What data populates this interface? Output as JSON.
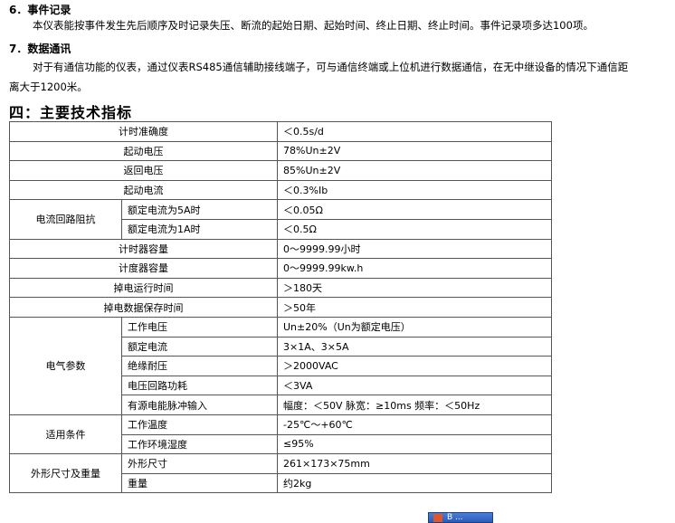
{
  "section6": {
    "title": "6．事件记录",
    "text": "本仪表能按事件发生先后顺序及时记录失压、断流的起始日期、起始时间、终止日期、终止时间。事件记录项多达100项。"
  },
  "section7": {
    "title": "7．数据通讯",
    "text_line1": "对于有通信功能的仪表，通过仪表RS485通信辅助接线端子，可与通信终端或上位机进行数据通信，在无中继设备的情况下通信距",
    "text_line2": "离大于1200米。"
  },
  "heading": "四：主要技术指标",
  "table": {
    "rows": {
      "timing_accuracy": {
        "label": "计时准确度",
        "value": "＜0.5s/d"
      },
      "start_voltage": {
        "label": "起动电压",
        "value": "78%Un±2V"
      },
      "return_voltage": {
        "label": "返回电压",
        "value": "85%Un±2V"
      },
      "start_current": {
        "label": "起动电流",
        "value": "＜0.3%Ib"
      },
      "current_impedance": {
        "group": "电流回路阻抗",
        "rated_5a": {
          "label": "额定电流为5A时",
          "value": "＜0.05Ω"
        },
        "rated_1a": {
          "label": "额定电流为1A时",
          "value": "＜0.5Ω"
        }
      },
      "timer_capacity": {
        "label": "计时器容量",
        "value": "0～9999.99小时"
      },
      "meter_capacity": {
        "label": "计度器容量",
        "value": "0～9999.99kw.h"
      },
      "power_off_run": {
        "label": "掉电运行时间",
        "value": "＞180天"
      },
      "power_off_retention": {
        "label": "掉电数据保存时间",
        "value": "＞50年"
      },
      "electrical": {
        "group": "电气参数",
        "working_voltage": {
          "label": "工作电压",
          "value": "Un±20%（Un为额定电压）"
        },
        "rated_current": {
          "label": "额定电流",
          "value": "3×1A、3×5A"
        },
        "insulation": {
          "label": "绝缘耐压",
          "value": "＞2000VAC"
        },
        "voltage_power": {
          "label": "电压回路功耗",
          "value": "＜3VA"
        },
        "pulse_input": {
          "label": "有源电能脉冲输入",
          "value": "幅度：＜50V   脉宽：≥10ms   频率：＜50Hz"
        }
      },
      "conditions": {
        "group": "适用条件",
        "working_temp": {
          "label": "工作温度",
          "value": "-25℃～+60℃"
        },
        "working_humidity": {
          "label": "工作环境湿度",
          "value": "≤95%"
        }
      },
      "dimensions": {
        "group": "外形尺寸及重量",
        "size": {
          "label": "外形尺寸",
          "value": "261×173×75mm"
        },
        "weight": {
          "label": "重量",
          "value": "约2kg"
        }
      }
    }
  },
  "taskbar_widget": {
    "text": "B ..."
  }
}
